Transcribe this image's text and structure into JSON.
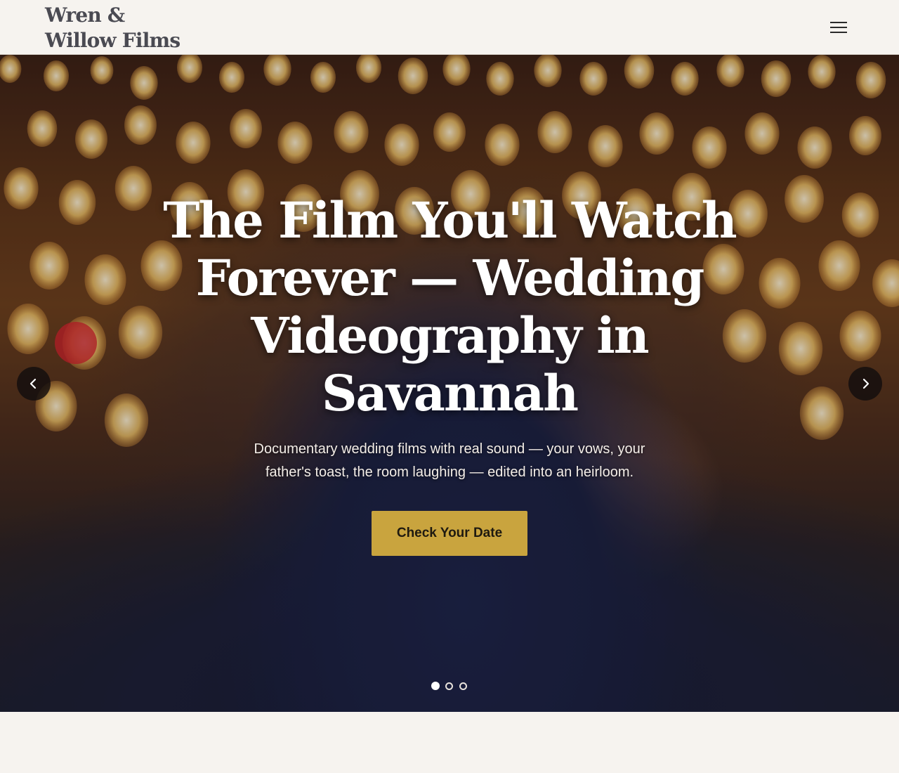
{
  "header": {
    "logo_line1": "Wren &",
    "logo_line2": "Willow Films",
    "menu_icon": "hamburger-menu-icon"
  },
  "hero": {
    "title": "The Film You'll Watch Forever — Wedding Videography in Savannah",
    "subtitle": "Documentary wedding films with real sound — your vows, your father's toast, the room laughing — edited into an heirloom.",
    "cta_label": "Check Your Date",
    "prev_icon": "chevron-left-icon",
    "next_icon": "chevron-right-icon",
    "slides_total": 3,
    "active_slide": 1
  },
  "colors": {
    "background": "#f6f3ef",
    "accent": "#c9a43e",
    "logo_text": "#4a4a52",
    "arrow_bg": "#120e0e"
  }
}
